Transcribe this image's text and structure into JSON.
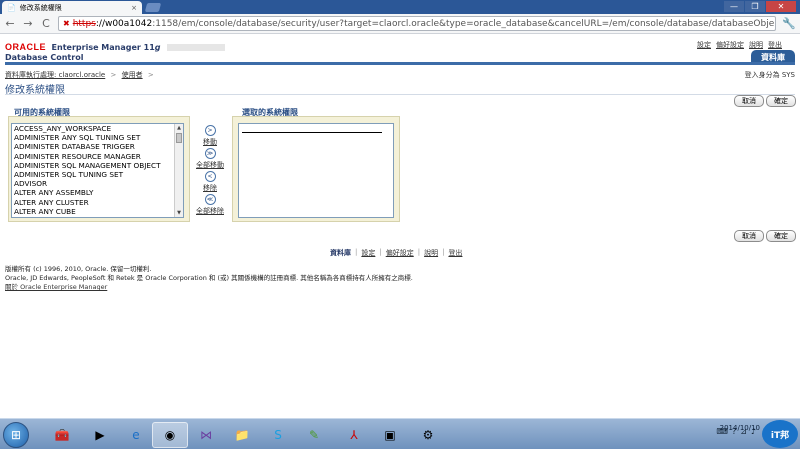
{
  "browser": {
    "tab_title": "修改系統權限",
    "tab_close": "×",
    "url_protocol": "https",
    "url_host": "://w00a1042",
    "url_rest": ":1158/em/console/database/security/user?target=claorcl.oracle&type=oracle_database&cancelURL=/em/console/database/databaseObje",
    "window_buttons": [
      "—",
      "❐",
      "✕"
    ]
  },
  "header": {
    "oracle_logo": "ORACLE",
    "product": "Enterprise Manager 11",
    "product_suffix": "g",
    "subtitle": "Database Control",
    "links": [
      "設定",
      "偏好設定",
      "說明",
      "登出"
    ],
    "active_tab": "資料庫"
  },
  "breadcrumb": {
    "items": [
      "資料庫執行處理: claorcl.oracle",
      "使用者"
    ],
    "sep": ">"
  },
  "login_as": "登入身分為 SYS",
  "page_title": "修改系統權限",
  "buttons": {
    "cancel": "取消",
    "ok": "確定"
  },
  "available": {
    "title": "可用的系統權限",
    "options": [
      "ACCESS_ANY_WORKSPACE",
      "ADMINISTER ANY SQL TUNING SET",
      "ADMINISTER DATABASE TRIGGER",
      "ADMINISTER RESOURCE MANAGER",
      "ADMINISTER SQL MANAGEMENT OBJECT",
      "ADMINISTER SQL TUNING SET",
      "ADVISOR",
      "ALTER ANY ASSEMBLY",
      "ALTER ANY CLUSTER",
      "ALTER ANY CUBE"
    ]
  },
  "selected": {
    "title": "選取的系統權限"
  },
  "shuttle": {
    "move": "移動",
    "move_all": "全部移動",
    "remove": "移除",
    "remove_all": "全部移除",
    "move_glyph": ">",
    "move_all_glyph": "≫",
    "remove_glyph": "<",
    "remove_all_glyph": "≪"
  },
  "footer_nav": [
    "資料庫",
    "設定",
    "偏好設定",
    "說明",
    "登出"
  ],
  "footer_pipe": "|",
  "copyright": {
    "line1": "版權所有 (c) 1996, 2010, Oracle. 保留一切權利.",
    "line2": "Oracle, JD Edwards, PeopleSoft 和 Retek 是 Oracle Corporation 和 (或) 其關係機構的註冊商標. 其他名稱為各商標持有人所擁有之商標.",
    "about_link": "關於 Oracle Enterprise Manager"
  },
  "taskbar": {
    "date": "2014/10/10",
    "logo_text": "iT邦"
  }
}
